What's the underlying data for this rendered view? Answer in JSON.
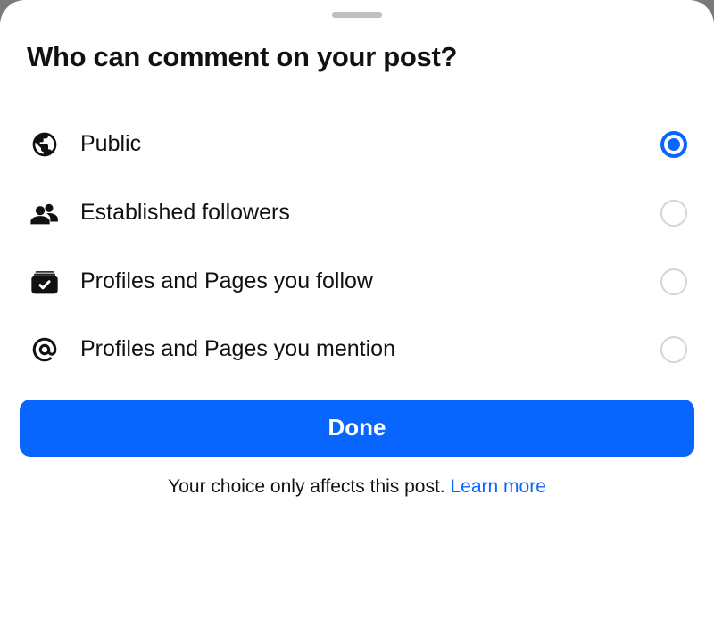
{
  "title": "Who can comment on your post?",
  "options": [
    {
      "id": "public",
      "label": "Public",
      "icon": "globe-icon",
      "selected": true
    },
    {
      "id": "established-followers",
      "label": "Established followers",
      "icon": "people-icon",
      "selected": false
    },
    {
      "id": "follow",
      "label": "Profiles and Pages you follow",
      "icon": "folder-check-icon",
      "selected": false
    },
    {
      "id": "mention",
      "label": "Profiles and Pages you mention",
      "icon": "at-icon",
      "selected": false
    }
  ],
  "done_label": "Done",
  "footer_text": "Your choice only affects this post. ",
  "learn_more_label": "Learn more",
  "colors": {
    "accent": "#0866ff"
  }
}
